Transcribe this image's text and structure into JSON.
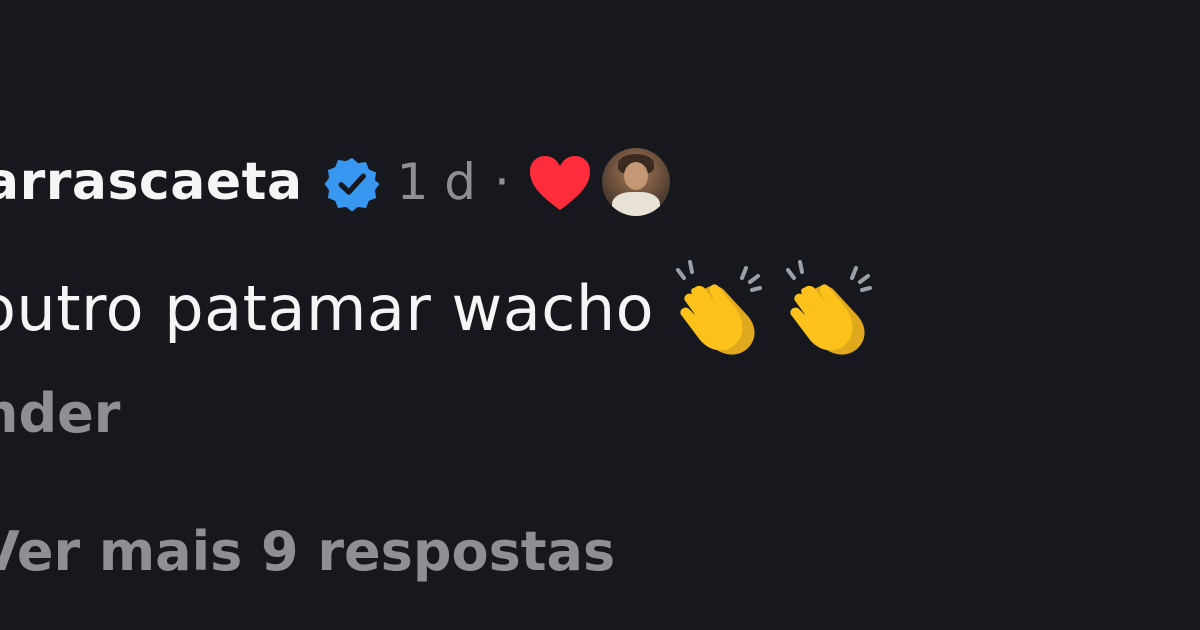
{
  "comment": {
    "username": "arrascaeta",
    "verified_icon": "verified-badge-icon",
    "timestamp": "1 d",
    "separator": "·",
    "liked_by_author_icon": "heart-icon",
    "text": "outro patamar wacho",
    "emojis": [
      "clapping-hands-icon",
      "clapping-hands-icon"
    ],
    "reply_label": "nder",
    "more_replies_label": "Ver mais 9 respostas"
  },
  "colors": {
    "background": "#16181d",
    "primary_text": "#f5f5f5",
    "secondary_text": "#8e8f94",
    "verified_blue": "#3897f0",
    "heart_red": "#ff2d3b",
    "clap_yellow": "#fcc21b"
  }
}
